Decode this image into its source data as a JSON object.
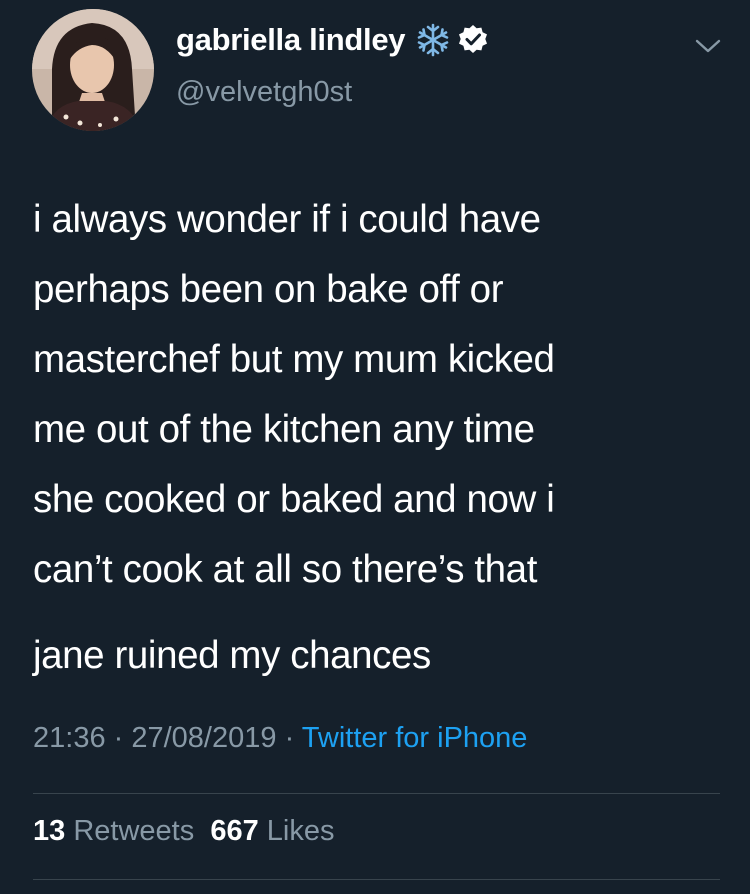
{
  "author": {
    "display_name": "gabriella lindley",
    "handle": "@velvetgh0st",
    "badge_icons": [
      "snowflake-icon",
      "verified-badge-icon"
    ]
  },
  "tweet": {
    "lines_para1": [
      "i always wonder if i could have",
      "perhaps been on bake off or",
      "masterchef but my mum kicked",
      "me out of the kitchen any time",
      "she cooked or baked and now i",
      "can’t cook at all so there’s that"
    ],
    "para2": "jane ruined my chances"
  },
  "meta": {
    "time": "21:36",
    "separator": " · ",
    "date": "27/08/2019",
    "source": "Twitter for iPhone"
  },
  "stats": {
    "retweets_count": "13",
    "retweets_label": "Retweets",
    "likes_count": "667",
    "likes_label": "Likes"
  },
  "colors": {
    "background": "#15202b",
    "text": "#ffffff",
    "secondary": "#8899a6",
    "accent": "#1da1f2",
    "divider": "#38444d"
  }
}
